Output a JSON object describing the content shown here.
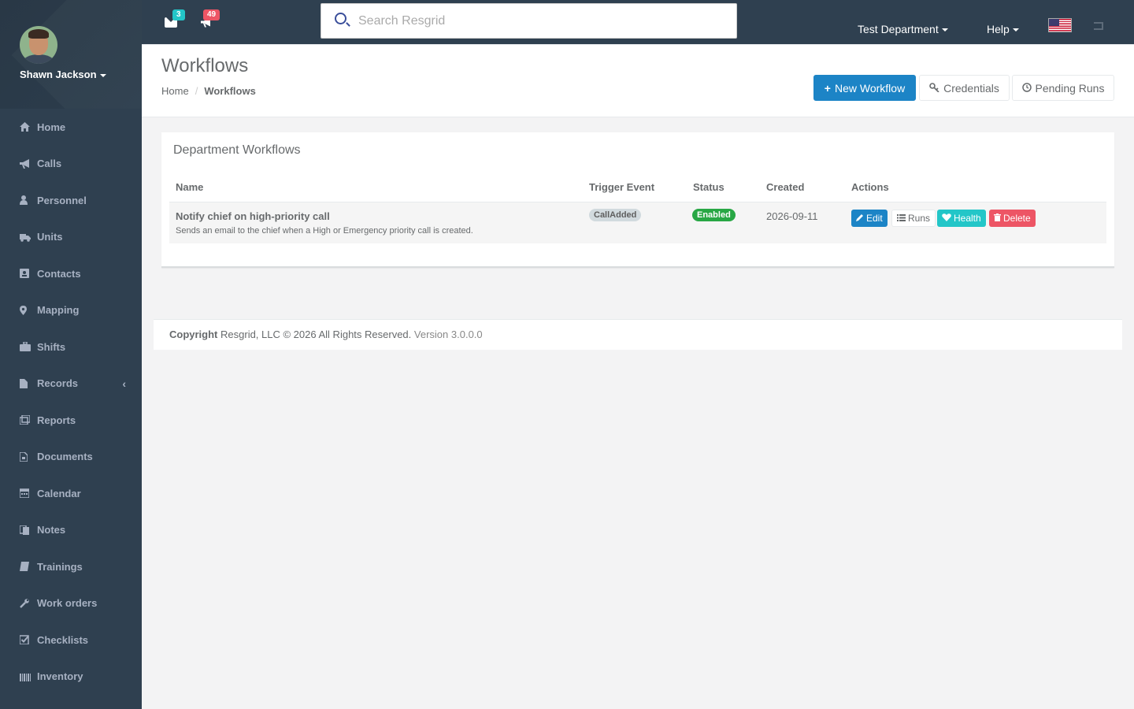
{
  "user": {
    "name": "Shawn Jackson"
  },
  "sidebar": {
    "items": [
      {
        "label": "Home",
        "icon": "home-icon"
      },
      {
        "label": "Calls",
        "icon": "bullhorn-icon"
      },
      {
        "label": "Personnel",
        "icon": "user-icon"
      },
      {
        "label": "Units",
        "icon": "truck-icon"
      },
      {
        "label": "Contacts",
        "icon": "contact-card-icon"
      },
      {
        "label": "Mapping",
        "icon": "map-marker-icon"
      },
      {
        "label": "Shifts",
        "icon": "briefcase-icon"
      },
      {
        "label": "Records",
        "icon": "file-icon"
      },
      {
        "label": "Reports",
        "icon": "report-icon"
      },
      {
        "label": "Documents",
        "icon": "document-icon"
      },
      {
        "label": "Calendar",
        "icon": "calendar-icon"
      },
      {
        "label": "Notes",
        "icon": "notes-icon"
      },
      {
        "label": "Trainings",
        "icon": "book-icon"
      },
      {
        "label": "Work orders",
        "icon": "wrench-icon"
      },
      {
        "label": "Checklists",
        "icon": "checklist-icon"
      },
      {
        "label": "Inventory",
        "icon": "barcode-icon"
      }
    ],
    "records_chevron": "‹"
  },
  "topbar": {
    "messages_count": "3",
    "alerts_count": "49",
    "search_placeholder": "Search Resgrid",
    "department": "Test Department",
    "help": "Help"
  },
  "page": {
    "title": "Workflows",
    "breadcrumb": {
      "home": "Home",
      "separator": "/",
      "current": "Workflows"
    },
    "buttons": {
      "new_workflow": "New Workflow",
      "credentials": "Credentials",
      "pending_runs": "Pending Runs"
    }
  },
  "panel": {
    "title": "Department Workflows",
    "columns": [
      "Name",
      "Trigger Event",
      "Status",
      "Created",
      "Actions"
    ],
    "rows": [
      {
        "name": "Notify chief on high-priority call",
        "description": "Sends an email to the chief when a High or Emergency priority call is created.",
        "trigger": "CallAdded",
        "status": "Enabled",
        "created": "2026-09-11",
        "actions": {
          "edit": "Edit",
          "runs": "Runs",
          "health": "Health",
          "delete": "Delete"
        }
      }
    ]
  },
  "footer": {
    "copyright_bold": "Copyright",
    "copyright_text": "Resgrid, LLC © 2026 All Rights Reserved.",
    "version": "Version 3.0.0.0"
  },
  "colors": {
    "sidebar_bg": "#2f4050",
    "primary": "#1c84c6",
    "info": "#23c6c8",
    "danger": "#ed5565",
    "success": "#28a745"
  }
}
